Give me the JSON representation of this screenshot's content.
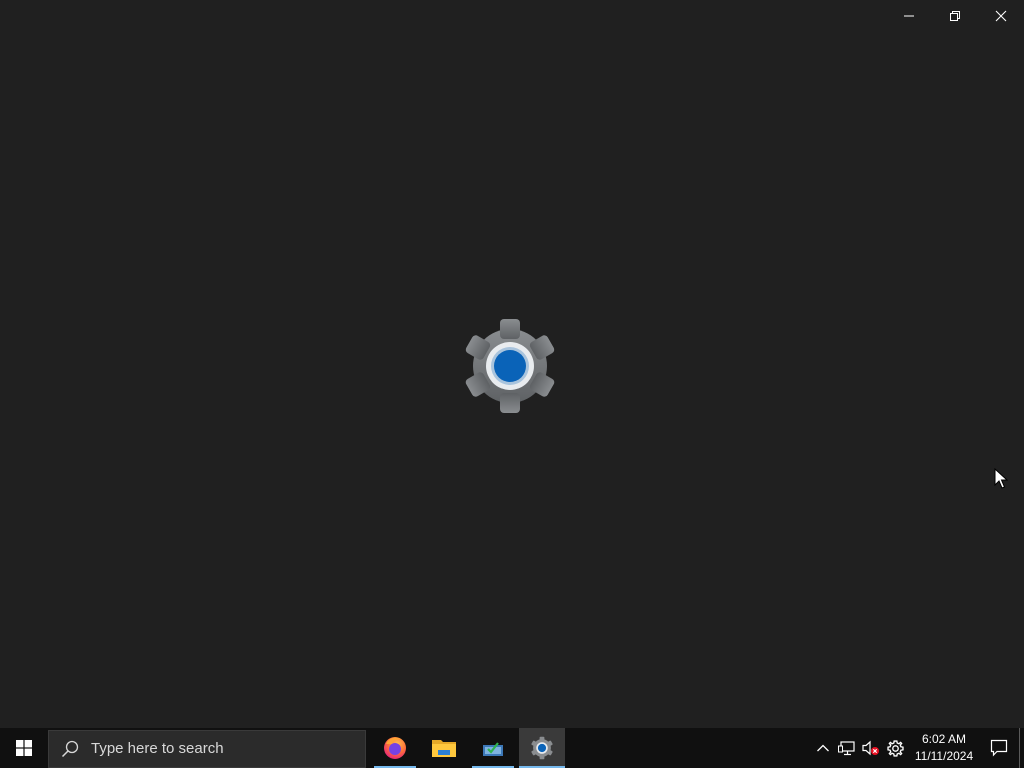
{
  "window": {
    "app": "Settings",
    "controls": {
      "minimize_icon": "minimize-icon",
      "restore_icon": "restore-icon",
      "close_icon": "close-icon"
    },
    "splash_icon": "settings-gear-icon"
  },
  "taskbar": {
    "start_icon": "windows-logo-icon",
    "search": {
      "placeholder": "Type here to search",
      "value": ""
    },
    "apps": [
      {
        "name": "Firefox",
        "icon": "firefox-icon",
        "running": true,
        "active": false
      },
      {
        "name": "File Explorer",
        "icon": "folder-icon",
        "running": false,
        "active": false
      },
      {
        "name": "Store",
        "icon": "store-icon",
        "running": true,
        "active": false
      },
      {
        "name": "Settings",
        "icon": "settings-gear-icon",
        "running": true,
        "active": true
      }
    ],
    "tray": {
      "icons": [
        "chevron-up-icon",
        "network-icon",
        "volume-muted-icon",
        "gear-icon"
      ],
      "time": "6:02 AM",
      "date": "11/11/2024",
      "notification_icon": "notification-icon"
    }
  },
  "colors": {
    "background": "#202020",
    "taskbar": "#101010",
    "accent": "#76b9ed",
    "gear_blue": "#0a63b8"
  }
}
